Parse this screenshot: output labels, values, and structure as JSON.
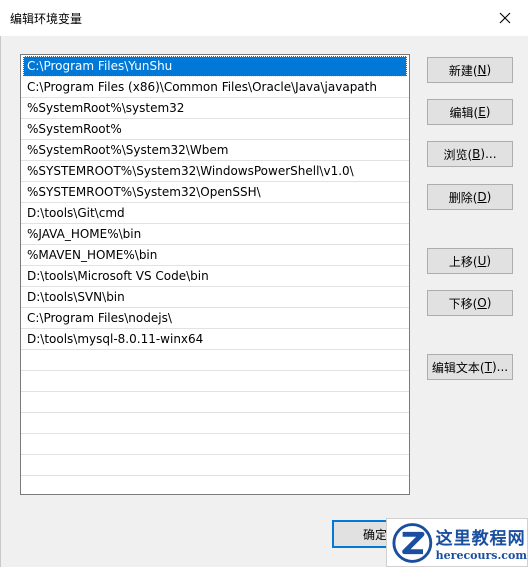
{
  "window": {
    "title": "编辑环境变量"
  },
  "paths": [
    "C:\\Program Files\\YunShu",
    "C:\\Program Files (x86)\\Common Files\\Oracle\\Java\\javapath",
    "%SystemRoot%\\system32",
    "%SystemRoot%",
    "%SystemRoot%\\System32\\Wbem",
    "%SYSTEMROOT%\\System32\\WindowsPowerShell\\v1.0\\",
    "%SYSTEMROOT%\\System32\\OpenSSH\\",
    "D:\\tools\\Git\\cmd",
    "%JAVA_HOME%\\bin",
    "%MAVEN_HOME%\\bin",
    "D:\\tools\\Microsoft VS Code\\bin",
    "D:\\tools\\SVN\\bin",
    "C:\\Program Files\\nodejs\\",
    "D:\\tools\\mysql-8.0.11-winx64"
  ],
  "selected_index": 0,
  "buttons": {
    "new": {
      "label": "新建(",
      "key": "N",
      "suffix": ")"
    },
    "edit": {
      "label": "编辑(",
      "key": "E",
      "suffix": ")"
    },
    "browse": {
      "label": "浏览(",
      "key": "B",
      "suffix": ")..."
    },
    "delete": {
      "label": "删除(",
      "key": "D",
      "suffix": ")"
    },
    "move_up": {
      "label": "上移(",
      "key": "U",
      "suffix": ")"
    },
    "move_down": {
      "label": "下移(",
      "key": "O",
      "suffix": ")"
    },
    "edit_text": {
      "label": "编辑文本(",
      "key": "T",
      "suffix": ")..."
    },
    "ok": {
      "label": "确定"
    }
  },
  "watermark": {
    "title": "这里教程网",
    "url": "herecours.com"
  }
}
